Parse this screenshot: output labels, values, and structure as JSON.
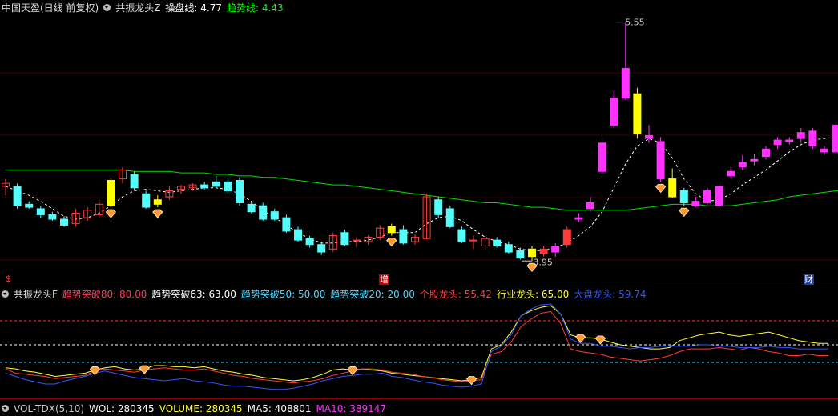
{
  "main_header": {
    "title": "中国天盈(日线 前复权)",
    "indicator_name": "共振龙头Z",
    "line1_label": "操盘线: 4.77",
    "line2_label": "趋势线: 4.43",
    "line1_color": "#ffffff",
    "line2_color": "#00ff00"
  },
  "sub_header": {
    "indicator_name": "共振龙头F",
    "items": [
      {
        "text": "趋势突破80: 80.00",
        "color": "#ff3b5c"
      },
      {
        "text": "趋势突破63: 63.00",
        "color": "#ffffff"
      },
      {
        "text": "趋势突破50: 50.00",
        "color": "#4fd7ff"
      },
      {
        "text": "趋势突破20: 20.00",
        "color": "#4fd7ff"
      },
      {
        "text": "个股龙头: 55.42",
        "color": "#ff3b3b"
      },
      {
        "text": "行业龙头: 65.00",
        "color": "#ffff33"
      },
      {
        "text": "大盘龙头: 59.74",
        "color": "#3355ff"
      }
    ]
  },
  "vol_header": {
    "items": [
      {
        "text": "VOL-TDX(5,10)",
        "color": "#cccccc"
      },
      {
        "text": "WOL: 280345",
        "color": "#ffffff"
      },
      {
        "text": "VOLUME: 280345",
        "color": "#ffff33"
      },
      {
        "text": "MA5: 408801",
        "color": "#ffffff"
      },
      {
        "text": "MA10: 389147",
        "color": "#ff33ff"
      }
    ]
  },
  "annotations": {
    "high_price": "5.55",
    "low_price": "3.95"
  },
  "markers": {
    "left": "$",
    "middle": "增",
    "right": "财"
  },
  "chart_data": [
    {
      "type": "candlestick",
      "title": "中国天盈(日线 前复权)",
      "colors": {
        "up": "#ff3b3b",
        "down": "#54fcfc",
        "signal": "#ffff00",
        "surge": "#ff33ff"
      },
      "candles": [
        {
          "o": 4.45,
          "h": 4.5,
          "l": 4.39,
          "c": 4.47
        },
        {
          "o": 4.45,
          "h": 4.47,
          "l": 4.3,
          "c": 4.32
        },
        {
          "o": 4.33,
          "h": 4.35,
          "l": 4.3,
          "c": 4.31
        },
        {
          "o": 4.3,
          "h": 4.32,
          "l": 4.24,
          "c": 4.26
        },
        {
          "o": 4.26,
          "h": 4.28,
          "l": 4.22,
          "c": 4.23
        },
        {
          "o": 4.23,
          "h": 4.25,
          "l": 4.18,
          "c": 4.19
        },
        {
          "o": 4.2,
          "h": 4.3,
          "l": 4.18,
          "c": 4.27
        },
        {
          "o": 4.24,
          "h": 4.31,
          "l": 4.22,
          "c": 4.29
        },
        {
          "o": 4.26,
          "h": 4.36,
          "l": 4.24,
          "c": 4.33
        },
        {
          "o": 4.32,
          "h": 4.5,
          "l": 4.31,
          "c": 4.49
        },
        {
          "o": 4.5,
          "h": 4.58,
          "l": 4.47,
          "c": 4.56
        },
        {
          "o": 4.53,
          "h": 4.55,
          "l": 4.42,
          "c": 4.44
        },
        {
          "o": 4.4,
          "h": 4.42,
          "l": 4.3,
          "c": 4.31
        },
        {
          "o": 4.36,
          "h": 4.39,
          "l": 4.31,
          "c": 4.33
        },
        {
          "o": 4.38,
          "h": 4.45,
          "l": 4.36,
          "c": 4.42
        },
        {
          "o": 4.43,
          "h": 4.46,
          "l": 4.4,
          "c": 4.45
        },
        {
          "o": 4.44,
          "h": 4.47,
          "l": 4.42,
          "c": 4.46
        },
        {
          "o": 4.46,
          "h": 4.48,
          "l": 4.43,
          "c": 4.44
        },
        {
          "o": 4.48,
          "h": 4.52,
          "l": 4.44,
          "c": 4.45
        },
        {
          "o": 4.48,
          "h": 4.51,
          "l": 4.4,
          "c": 4.42
        },
        {
          "o": 4.49,
          "h": 4.51,
          "l": 4.32,
          "c": 4.34
        },
        {
          "o": 4.33,
          "h": 4.35,
          "l": 4.27,
          "c": 4.28
        },
        {
          "o": 4.32,
          "h": 4.34,
          "l": 4.22,
          "c": 4.23
        },
        {
          "o": 4.28,
          "h": 4.3,
          "l": 4.22,
          "c": 4.23
        },
        {
          "o": 4.24,
          "h": 4.26,
          "l": 4.14,
          "c": 4.15
        },
        {
          "o": 4.16,
          "h": 4.18,
          "l": 4.08,
          "c": 4.09
        },
        {
          "o": 4.1,
          "h": 4.12,
          "l": 4.04,
          "c": 4.06
        },
        {
          "o": 4.06,
          "h": 4.08,
          "l": 3.99,
          "c": 4.01
        },
        {
          "o": 4.03,
          "h": 4.14,
          "l": 4.01,
          "c": 4.12
        },
        {
          "o": 4.14,
          "h": 4.16,
          "l": 4.05,
          "c": 4.06
        },
        {
          "o": 4.09,
          "h": 4.11,
          "l": 4.04,
          "c": 4.09
        },
        {
          "o": 4.08,
          "h": 4.12,
          "l": 4.06,
          "c": 4.11
        },
        {
          "o": 4.11,
          "h": 4.19,
          "l": 4.09,
          "c": 4.17
        },
        {
          "o": 4.14,
          "h": 4.2,
          "l": 4.12,
          "c": 4.18
        },
        {
          "o": 4.16,
          "h": 4.19,
          "l": 4.06,
          "c": 4.07
        },
        {
          "o": 4.08,
          "h": 4.13,
          "l": 4.06,
          "c": 4.11
        },
        {
          "o": 4.1,
          "h": 4.4,
          "l": 4.1,
          "c": 4.38
        },
        {
          "o": 4.36,
          "h": 4.38,
          "l": 4.24,
          "c": 4.26
        },
        {
          "o": 4.3,
          "h": 4.32,
          "l": 4.17,
          "c": 4.18
        },
        {
          "o": 4.16,
          "h": 4.18,
          "l": 4.07,
          "c": 4.08
        },
        {
          "o": 4.09,
          "h": 4.12,
          "l": 4.03,
          "c": 4.09
        },
        {
          "o": 4.05,
          "h": 4.12,
          "l": 4.03,
          "c": 4.1
        },
        {
          "o": 4.09,
          "h": 4.11,
          "l": 4.04,
          "c": 4.05
        },
        {
          "o": 4.06,
          "h": 4.08,
          "l": 4.0,
          "c": 4.01
        },
        {
          "o": 4.02,
          "h": 4.04,
          "l": 3.96,
          "c": 3.97
        },
        {
          "o": 3.98,
          "h": 4.05,
          "l": 3.95,
          "c": 4.03
        },
        {
          "o": 4.0,
          "h": 4.05,
          "l": 3.98,
          "c": 4.03
        },
        {
          "o": 4.05,
          "h": 4.07,
          "l": 3.98,
          "c": 4.01
        },
        {
          "o": 4.06,
          "h": 4.18,
          "l": 4.04,
          "c": 4.16
        },
        {
          "o": 4.23,
          "h": 4.27,
          "l": 4.21,
          "c": 4.24
        },
        {
          "o": 4.3,
          "h": 4.38,
          "l": 4.28,
          "c": 4.34
        },
        {
          "o": 4.55,
          "h": 4.77,
          "l": 4.53,
          "c": 4.74
        },
        {
          "o": 4.86,
          "h": 5.09,
          "l": 4.84,
          "c": 5.04
        },
        {
          "o": 5.24,
          "h": 5.55,
          "l": 5.03,
          "c": 5.04
        },
        {
          "o": 5.07,
          "h": 5.11,
          "l": 4.77,
          "c": 4.8
        },
        {
          "o": 4.79,
          "h": 4.86,
          "l": 4.74,
          "c": 4.77
        },
        {
          "o": 4.75,
          "h": 4.78,
          "l": 4.48,
          "c": 4.5
        },
        {
          "o": 4.5,
          "h": 4.57,
          "l": 4.37,
          "c": 4.38
        },
        {
          "o": 4.42,
          "h": 4.44,
          "l": 4.32,
          "c": 4.34
        },
        {
          "o": 4.35,
          "h": 4.38,
          "l": 4.31,
          "c": 4.32
        },
        {
          "o": 4.42,
          "h": 4.44,
          "l": 4.33,
          "c": 4.34
        },
        {
          "o": 4.32,
          "h": 4.47,
          "l": 4.3,
          "c": 4.45
        },
        {
          "o": 4.52,
          "h": 4.58,
          "l": 4.5,
          "c": 4.55
        },
        {
          "o": 4.58,
          "h": 4.66,
          "l": 4.56,
          "c": 4.61
        },
        {
          "o": 4.62,
          "h": 4.67,
          "l": 4.59,
          "c": 4.63
        },
        {
          "o": 4.65,
          "h": 4.72,
          "l": 4.63,
          "c": 4.7
        },
        {
          "o": 4.73,
          "h": 4.78,
          "l": 4.7,
          "c": 4.76
        },
        {
          "o": 4.76,
          "h": 4.78,
          "l": 4.73,
          "c": 4.75
        },
        {
          "o": 4.77,
          "h": 4.84,
          "l": 4.74,
          "c": 4.81
        },
        {
          "o": 4.82,
          "h": 4.84,
          "l": 4.7,
          "c": 4.72
        },
        {
          "o": 4.7,
          "h": 4.72,
          "l": 4.66,
          "c": 4.68
        },
        {
          "o": 4.68,
          "h": 4.88,
          "l": 4.66,
          "c": 4.86
        },
        {
          "o": 4.76,
          "h": 4.9,
          "l": 4.74,
          "c": 4.86
        }
      ],
      "signal_bars": [
        9,
        13,
        33,
        45,
        54,
        57
      ],
      "surge_bars": [
        46,
        47,
        48,
        49,
        50,
        51,
        52,
        53,
        54,
        55,
        56,
        59,
        60,
        61,
        62,
        63,
        64,
        65,
        66,
        67,
        68,
        69,
        70,
        71
      ],
      "diamond_bars": [
        9,
        13,
        33,
        45,
        56,
        58
      ],
      "series": [
        {
          "color": "#ffffff",
          "dashed": true,
          "values": [
            4.45,
            4.42,
            4.39,
            4.35,
            4.3,
            4.25,
            4.23,
            4.24,
            4.27,
            4.32,
            4.38,
            4.42,
            4.43,
            4.42,
            4.41,
            4.42,
            4.43,
            4.44,
            4.44,
            4.43,
            4.4,
            4.35,
            4.29,
            4.24,
            4.19,
            4.14,
            4.1,
            4.07,
            4.07,
            4.08,
            4.08,
            4.09,
            4.11,
            4.14,
            4.14,
            4.14,
            4.2,
            4.24,
            4.25,
            4.22,
            4.16,
            4.11,
            4.08,
            4.06,
            4.03,
            4.02,
            4.02,
            4.04,
            4.07,
            4.12,
            4.18,
            4.28,
            4.44,
            4.6,
            4.72,
            4.77,
            4.74,
            4.64,
            4.5,
            4.4,
            4.35,
            4.36,
            4.4,
            4.46,
            4.51,
            4.56,
            4.62,
            4.68,
            4.73,
            4.76,
            4.77,
            4.78,
            4.77
          ]
        },
        {
          "color": "#00e000",
          "dashed": false,
          "values": [
            4.56,
            4.56,
            4.56,
            4.56,
            4.56,
            4.56,
            4.56,
            4.56,
            4.56,
            4.56,
            4.56,
            4.55,
            4.55,
            4.55,
            4.55,
            4.54,
            4.54,
            4.54,
            4.53,
            4.53,
            4.52,
            4.52,
            4.51,
            4.51,
            4.5,
            4.49,
            4.48,
            4.47,
            4.46,
            4.46,
            4.45,
            4.44,
            4.43,
            4.42,
            4.41,
            4.4,
            4.39,
            4.38,
            4.37,
            4.36,
            4.35,
            4.34,
            4.34,
            4.33,
            4.32,
            4.31,
            4.31,
            4.3,
            4.29,
            4.29,
            4.29,
            4.29,
            4.29,
            4.29,
            4.3,
            4.31,
            4.32,
            4.33,
            4.33,
            4.33,
            4.32,
            4.32,
            4.32,
            4.33,
            4.34,
            4.35,
            4.36,
            4.38,
            4.39,
            4.4,
            4.41,
            4.42,
            4.43
          ]
        }
      ]
    },
    {
      "type": "line",
      "title": "共振龙头F",
      "levels": [
        {
          "value": 80,
          "color": "#ff3b5c"
        },
        {
          "value": 63,
          "color": "#ffffff"
        },
        {
          "value": 50,
          "color": "#4fd7ff"
        },
        {
          "value": 20,
          "color": "#4fd7ff"
        }
      ],
      "ylim": [
        20,
        105
      ],
      "diamond_bars": [
        9,
        14,
        35,
        47,
        58,
        60
      ],
      "series": [
        {
          "name": "行业龙头",
          "color": "#ffff33",
          "values": [
            45,
            44,
            42,
            41,
            39,
            37,
            38,
            39,
            40,
            43,
            45,
            46,
            44,
            43,
            44,
            47,
            47,
            46,
            46,
            45,
            46,
            44,
            42,
            41,
            39,
            38,
            36,
            35,
            34,
            33,
            34,
            36,
            39,
            43,
            44,
            43,
            44,
            43,
            42,
            40,
            39,
            38,
            37,
            36,
            35,
            34,
            33,
            34,
            36,
            60,
            63,
            72,
            86,
            92,
            96,
            98,
            88,
            70,
            68,
            68,
            67,
            65,
            63,
            62,
            61,
            60,
            60,
            61,
            66,
            68,
            70,
            71,
            72,
            70,
            69,
            70,
            71,
            72,
            70,
            68,
            66,
            65,
            64,
            64
          ]
        },
        {
          "name": "个股龙头",
          "color": "#ff3b3b",
          "values": [
            44,
            40,
            39,
            38,
            37,
            35,
            36,
            37,
            38,
            42,
            44,
            43,
            42,
            41,
            43,
            44,
            45,
            44,
            43,
            43,
            44,
            42,
            40,
            38,
            37,
            35,
            34,
            33,
            32,
            31,
            32,
            33,
            35,
            38,
            40,
            42,
            44,
            44,
            43,
            41,
            40,
            39,
            37,
            36,
            34,
            33,
            32,
            33,
            34,
            56,
            58,
            65,
            76,
            82,
            89,
            91,
            78,
            60,
            58,
            57,
            56,
            54,
            53,
            52,
            51,
            52,
            53,
            55,
            58,
            60,
            60,
            60,
            61,
            60,
            59,
            61,
            60,
            58,
            57,
            55,
            55,
            56,
            55,
            55
          ]
        },
        {
          "name": "大盘龙头",
          "color": "#3355ff",
          "values": [
            40,
            37,
            34,
            32,
            30,
            30,
            33,
            35,
            37,
            40,
            42,
            40,
            38,
            36,
            35,
            34,
            33,
            34,
            35,
            33,
            32,
            31,
            29,
            28,
            28,
            27,
            26,
            25,
            25,
            26,
            28,
            30,
            33,
            35,
            37,
            38,
            39,
            39,
            40,
            37,
            36,
            34,
            32,
            31,
            29,
            28,
            27,
            28,
            30,
            58,
            62,
            70,
            86,
            94,
            99,
            100,
            88,
            67,
            64,
            64,
            62,
            62,
            61,
            60,
            61,
            61,
            62,
            62,
            62,
            62,
            63,
            63,
            62,
            62,
            61,
            61,
            61,
            62,
            61,
            61,
            60,
            60,
            60,
            60
          ]
        }
      ]
    }
  ]
}
